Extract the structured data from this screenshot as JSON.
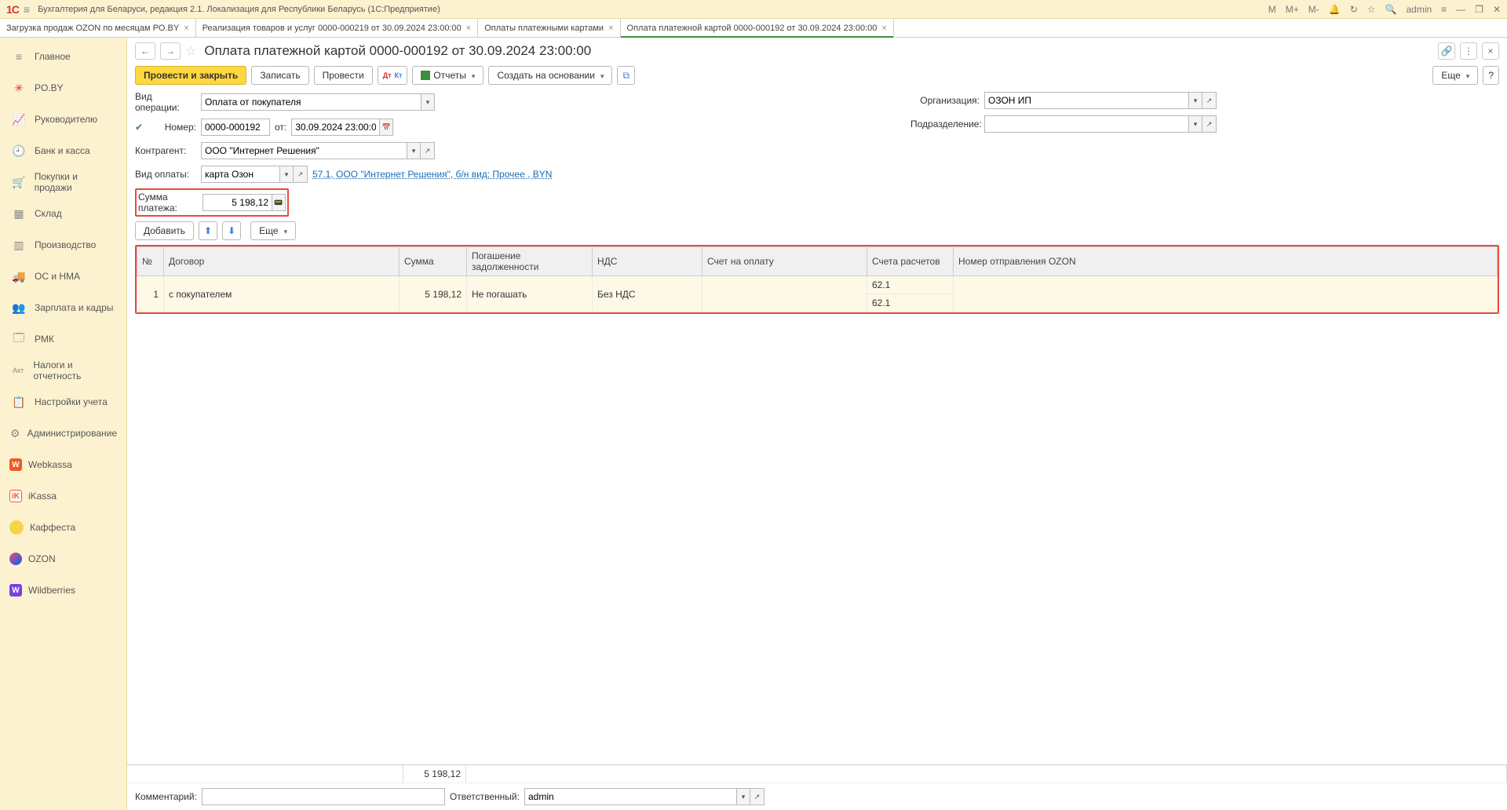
{
  "app": {
    "title": "Бухгалтерия для Беларуси, редакция 2.1. Локализация для Республики Беларусь   (1С:Предприятие)",
    "user": "admin",
    "zoom_m": "M",
    "zoom_mp": "M+",
    "zoom_mm": "M-"
  },
  "tabs": [
    {
      "label": "Загрузка продаж OZON по месяцам PO.BY",
      "active": false
    },
    {
      "label": "Реализация товаров и услуг 0000-000219 от 30.09.2024 23:00:00",
      "active": false
    },
    {
      "label": "Оплаты платежными картами",
      "active": false
    },
    {
      "label": "Оплата платежной картой 0000-000192 от 30.09.2024 23:00:00",
      "active": true
    }
  ],
  "sidebar": [
    {
      "label": "Главное",
      "icon": "≡"
    },
    {
      "label": "PO.BY",
      "icon": "✳",
      "cls": "red"
    },
    {
      "label": "Руководителю",
      "icon": "📈"
    },
    {
      "label": "Банк и касса",
      "icon": "🕗"
    },
    {
      "label": "Покупки и продажи",
      "icon": "🛒"
    },
    {
      "label": "Склад",
      "icon": "▦"
    },
    {
      "label": "Производство",
      "icon": "⚙"
    },
    {
      "label": "ОС и НМА",
      "icon": "🚚"
    },
    {
      "label": "Зарплата и кадры",
      "icon": "👥"
    },
    {
      "label": "РМК",
      "icon": "🗔"
    },
    {
      "label": "Налоги и отчетность",
      "icon": "Aк"
    },
    {
      "label": "Настройки учета",
      "icon": "📋"
    },
    {
      "label": "Администрирование",
      "icon": "⚙"
    },
    {
      "label": "Webkassa",
      "icon": "W",
      "cls": "orange"
    },
    {
      "label": "iKassa",
      "icon": "iK",
      "cls": "orange"
    },
    {
      "label": "Каффеста",
      "icon": " ",
      "cls": "yellow"
    },
    {
      "label": "OZON",
      "icon": "",
      "cls": "ozon"
    },
    {
      "label": "Wildberries",
      "icon": "W",
      "cls": "purple"
    }
  ],
  "page": {
    "title": "Оплата платежной картой 0000-000192 от 30.09.2024 23:00:00"
  },
  "toolbar": {
    "post_close": "Провести и закрыть",
    "save": "Записать",
    "post": "Провести",
    "reports": "Отчеты",
    "create_based": "Создать на основании",
    "more": "Еще"
  },
  "form": {
    "op_type_label": "Вид операции:",
    "op_type": "Оплата от покупателя",
    "number_label": "Номер:",
    "number": "0000-000192",
    "from_label": "от:",
    "date": "30.09.2024 23:00:00",
    "counterparty_label": "Контрагент:",
    "counterparty": "ООО \"Интернет Решения\"",
    "pay_type_label": "Вид оплаты:",
    "pay_type": "карта Озон",
    "pay_link": "57.1, ООО \"Интернет Решения\",  б/н вид: Прочее , BYN",
    "sum_label": "Сумма платежа:",
    "sum": "5 198,12",
    "org_label": "Организация:",
    "org": "ОЗОН ИП",
    "dept_label": "Подразделение:",
    "dept": ""
  },
  "table_toolbar": {
    "add": "Добавить",
    "more": "Еще"
  },
  "table": {
    "headers": {
      "num": "№",
      "contract": "Договор",
      "sum": "Сумма",
      "debt": "Погашение задолженности",
      "vat": "НДС",
      "invoice": "Счет на оплату",
      "accounts": "Счета расчетов",
      "ozon_ship": "Номер отправления OZON"
    },
    "rows": [
      {
        "num": "1",
        "contract": "с покупателем",
        "sum": "5 198,12",
        "debt": "Не погашать",
        "vat": "Без НДС",
        "invoice": "",
        "acct1": "62.1",
        "acct2": "62.1",
        "ozon_ship": ""
      }
    ],
    "footer_sum": "5 198,12"
  },
  "bottom": {
    "comment_label": "Комментарий:",
    "comment": "",
    "responsible_label": "Ответственный:",
    "responsible": "admin"
  }
}
